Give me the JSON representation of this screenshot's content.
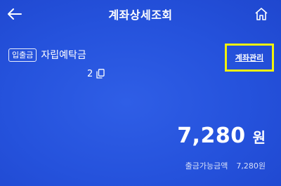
{
  "header": {
    "title": "계좌상세조회",
    "back_icon": "back-arrow-icon",
    "home_icon": "home-icon"
  },
  "account": {
    "type_badge": "입출금",
    "name": "자립예탁금",
    "number": "2",
    "copy_icon": "copy-icon",
    "manage_label": "계좌관리"
  },
  "balance": {
    "amount": "7,280",
    "unit": "원",
    "withdrawable_label": "출금가능금액",
    "withdrawable_value": "7,280원"
  },
  "colors": {
    "background": "#2552dc",
    "highlight_box": "#f2f20a",
    "text": "#ffffff"
  }
}
